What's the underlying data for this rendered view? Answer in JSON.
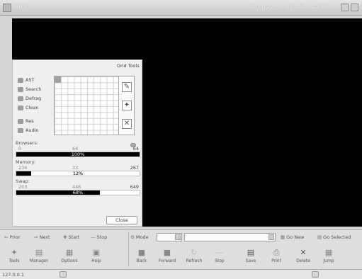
{
  "window": {
    "title": "Trek",
    "clock": "Sunday - April 13 - 15:00"
  },
  "side_panel": {
    "header": "Grid Tools",
    "tools": [
      {
        "label": "AST",
        "icon": "globe-icon"
      },
      {
        "label": "Search",
        "icon": "magnifier-icon"
      },
      {
        "label": "Defrag",
        "icon": "disk-icon"
      },
      {
        "label": "Clean",
        "icon": "broom-icon"
      },
      {
        "label": "Res",
        "icon": "monitor-icon"
      },
      {
        "label": "Audio",
        "icon": "speaker-icon"
      }
    ],
    "grid_buttons": [
      "edit-icon",
      "wrench-icon",
      "close-icon"
    ],
    "stats": [
      {
        "label": "Browsers:",
        "min": "0",
        "mid": "64",
        "max": "64",
        "percent_text": "100%",
        "fraction": 1.0
      },
      {
        "label": "Memory:",
        "min": "234",
        "mid": "33",
        "max": "267",
        "percent_text": "12%",
        "fraction": 0.12
      },
      {
        "label": "Swap:",
        "min": "203",
        "mid": "446",
        "max": "649",
        "percent_text": "68%",
        "fraction": 0.68
      }
    ],
    "close_label": "Close"
  },
  "nav_bar": {
    "prior": "Prior",
    "next": "Next",
    "start": "Start",
    "stop": "Stop",
    "mode": "Mode",
    "mode_value": "",
    "url_value": "",
    "go_new": "Go New",
    "go_selected": "Go Selected"
  },
  "buttons_left": [
    {
      "label": "Tools",
      "icon": "tools-icon"
    },
    {
      "label": "Manager",
      "icon": "manager-icon"
    },
    {
      "label": "Options",
      "icon": "options-icon"
    },
    {
      "label": "Help",
      "icon": "help-icon"
    }
  ],
  "buttons_right": [
    {
      "label": "Back",
      "icon": "back-icon"
    },
    {
      "label": "Forward",
      "icon": "forward-icon"
    },
    {
      "label": "Refresh",
      "icon": "refresh-icon"
    },
    {
      "label": "Stop",
      "icon": "stop-icon"
    },
    {
      "label": "Save",
      "icon": "save-icon"
    },
    {
      "label": "Print",
      "icon": "print-icon"
    },
    {
      "label": "Delete",
      "icon": "delete-icon"
    },
    {
      "label": "Jump",
      "icon": "jump-icon"
    }
  ],
  "status": {
    "address": "127.0.0.1"
  }
}
